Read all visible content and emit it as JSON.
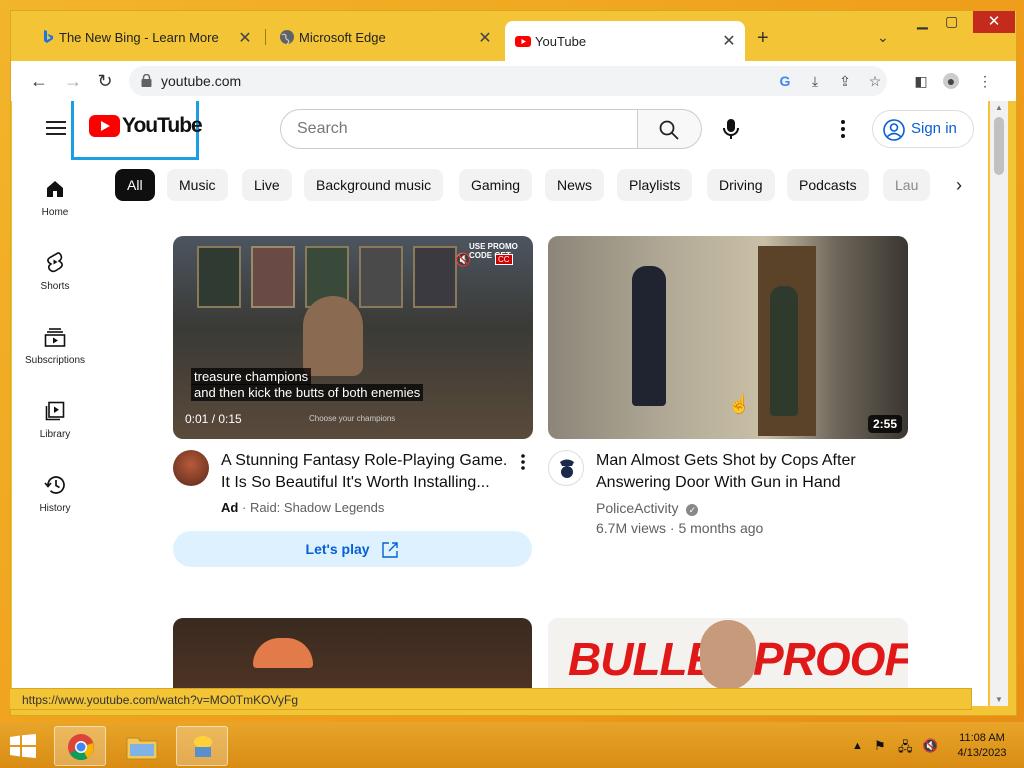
{
  "browser": {
    "tabs": [
      {
        "label": "The New Bing - Learn More",
        "icon": "bing-icon"
      },
      {
        "label": "Microsoft Edge",
        "icon": "globe-icon"
      },
      {
        "label": "YouTube",
        "icon": "youtube-icon"
      }
    ],
    "url": "youtube.com",
    "status_url": "https://www.youtube.com/watch?v=MO0TmKOVyFg"
  },
  "youtube": {
    "logo_text": "YouTube",
    "search_placeholder": "Search",
    "sign_in": "Sign in",
    "sidebar": [
      {
        "label": "Home",
        "icon": "home-icon"
      },
      {
        "label": "Shorts",
        "icon": "shorts-icon"
      },
      {
        "label": "Subscriptions",
        "icon": "subscriptions-icon"
      },
      {
        "label": "Library",
        "icon": "library-icon"
      },
      {
        "label": "History",
        "icon": "history-icon"
      }
    ],
    "chips": [
      "All",
      "Music",
      "Live",
      "Background music",
      "Gaming",
      "News",
      "Playlists",
      "Driving",
      "Podcasts",
      "Lau"
    ],
    "videos": [
      {
        "title_line1": "A Stunning Fantasy Role-Playing Game.",
        "title_line2": "It Is So Beautiful It's Worth Installing...",
        "ad_badge": "Ad",
        "channel": "Raid: Shadow Legends",
        "cta": "Let's play",
        "overlay_line1": "treasure champions",
        "overlay_line2": "and then kick the butts of both enemies",
        "time": "0:01 / 0:15",
        "small_caption": "Choose your champions",
        "promo": "USE PROMO CODE GET"
      },
      {
        "title_line1": "Man Almost Gets Shot by Cops After",
        "title_line2": "Answering Door With Gun in Hand",
        "channel": "PoliceActivity",
        "views": "6.7M views · 5 months ago",
        "duration": "2:55"
      },
      {
        "title_line1": "",
        "channel": ""
      },
      {
        "thumb_text1": "BULLET",
        "thumb_text2": "PROOF?"
      }
    ]
  },
  "taskbar": {
    "time": "11:08 AM",
    "date": "4/13/2023"
  },
  "colors": {
    "accent": "#065fd4",
    "yt_red": "#ff0000",
    "window_frame": "#f3c435",
    "close": "#c42b1c"
  }
}
